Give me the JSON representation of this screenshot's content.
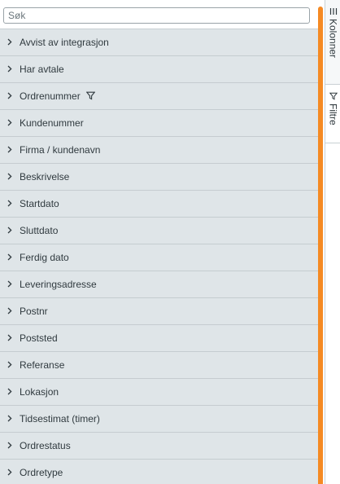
{
  "search": {
    "placeholder": "Søk",
    "value": ""
  },
  "columns": [
    {
      "label": "Avvist av integrasjon",
      "filtered": false
    },
    {
      "label": "Har avtale",
      "filtered": false
    },
    {
      "label": "Ordrenummer",
      "filtered": true
    },
    {
      "label": "Kundenummer",
      "filtered": false
    },
    {
      "label": "Firma / kundenavn",
      "filtered": false
    },
    {
      "label": "Beskrivelse",
      "filtered": false
    },
    {
      "label": "Startdato",
      "filtered": false
    },
    {
      "label": "Sluttdato",
      "filtered": false
    },
    {
      "label": "Ferdig dato",
      "filtered": false
    },
    {
      "label": "Leveringsadresse",
      "filtered": false
    },
    {
      "label": "Postnr",
      "filtered": false
    },
    {
      "label": "Poststed",
      "filtered": false
    },
    {
      "label": "Referanse",
      "filtered": false
    },
    {
      "label": "Lokasjon",
      "filtered": false
    },
    {
      "label": "Tidsestimat (timer)",
      "filtered": false
    },
    {
      "label": "Ordrestatus",
      "filtered": false
    },
    {
      "label": "Ordretype",
      "filtered": false
    }
  ],
  "side_tabs": {
    "columns": {
      "label": "Kolonner",
      "icon": "columns-icon"
    },
    "filters": {
      "label": "Filtre",
      "icon": "filter-icon"
    }
  },
  "colors": {
    "accent": "#f58a23",
    "panel_bg": "#dfe5e8"
  }
}
